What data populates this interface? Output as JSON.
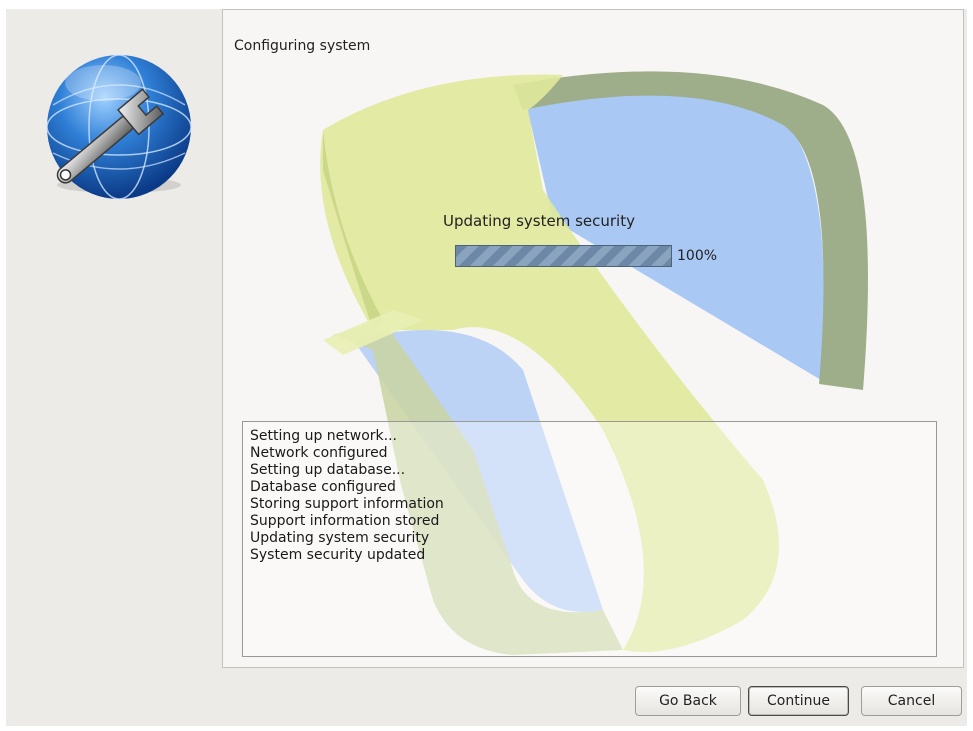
{
  "panel": {
    "title": "Configuring system"
  },
  "progress": {
    "status_text": "Updating system security",
    "value_percent": 100,
    "percent_label": "100%"
  },
  "log": {
    "lines": [
      "Setting up network...",
      "Network configured",
      "Setting up database...",
      "Database configured",
      "Storing support information",
      "Support information stored",
      "Updating system security",
      "System security updated"
    ]
  },
  "buttons": {
    "back": "Go Back",
    "continue": "Continue",
    "cancel": "Cancel"
  },
  "icons": {
    "logo": "globe-wrench-icon"
  },
  "colors": {
    "progress_fill": "#6c88a6",
    "art_yellow": "#dfe99a",
    "art_blue": "#a9c9f4",
    "art_rim": "#9fae8a"
  }
}
